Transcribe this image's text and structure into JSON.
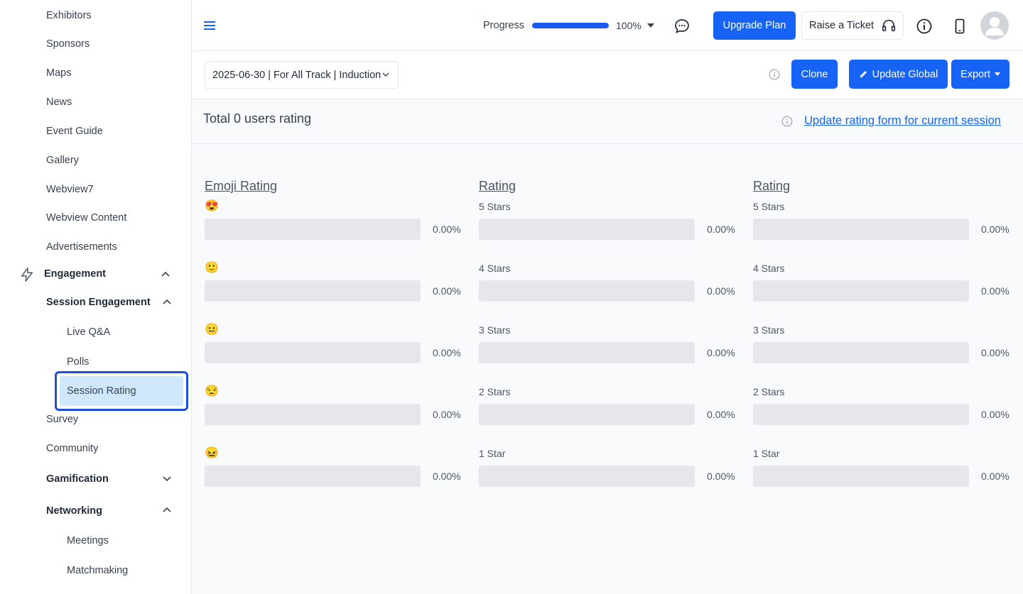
{
  "sidebar": {
    "items": {
      "exhibitors": "Exhibitors",
      "sponsors": "Sponsors",
      "maps": "Maps",
      "news": "News",
      "event_guide": "Event Guide",
      "gallery": "Gallery",
      "webview7": "Webview7",
      "webview_content": "Webview Content",
      "advertisements": "Advertisements",
      "engagement": "Engagement",
      "session_engagement": "Session Engagement",
      "live_qa": "Live Q&A",
      "polls": "Polls",
      "session_rating": "Session Rating",
      "survey": "Survey",
      "community": "Community",
      "gamification": "Gamification",
      "networking": "Networking",
      "meetings": "Meetings",
      "matchmaking": "Matchmaking"
    }
  },
  "header": {
    "progress_label": "Progress",
    "progress_value": 100,
    "progress_text": "100%",
    "upgrade_label": "Upgrade Plan",
    "ticket_label": "Raise a Ticket"
  },
  "filter": {
    "session_select": "2025-06-30 | For All Track | Induction",
    "clone_label": "Clone",
    "update_global_label": "Update Global",
    "export_label": "Export"
  },
  "summary": {
    "total_text": "Total 0 users rating",
    "update_link": "Update rating form for current session"
  },
  "colors": {
    "accent": "#1663f5",
    "active_border": "#1d4ed8",
    "active_bg": "#cfe8fb"
  },
  "rating_columns": [
    {
      "title": "Emoji Rating",
      "rows": [
        {
          "emoji": "😍",
          "label": "",
          "value": 0,
          "pct": "0.00%"
        },
        {
          "emoji": "🙂",
          "label": "",
          "value": 0,
          "pct": "0.00%"
        },
        {
          "emoji": "😐",
          "label": "",
          "value": 0,
          "pct": "0.00%"
        },
        {
          "emoji": "😒",
          "label": "",
          "value": 0,
          "pct": "0.00%"
        },
        {
          "emoji": "😖",
          "label": "",
          "value": 0,
          "pct": "0.00%"
        }
      ]
    },
    {
      "title": "Rating",
      "rows": [
        {
          "emoji": "",
          "label": "5 Stars",
          "value": 0,
          "pct": "0.00%"
        },
        {
          "emoji": "",
          "label": "4 Stars",
          "value": 0,
          "pct": "0.00%"
        },
        {
          "emoji": "",
          "label": "3 Stars",
          "value": 0,
          "pct": "0.00%"
        },
        {
          "emoji": "",
          "label": "2 Stars",
          "value": 0,
          "pct": "0.00%"
        },
        {
          "emoji": "",
          "label": "1 Star",
          "value": 0,
          "pct": "0.00%"
        }
      ]
    },
    {
      "title": "Rating",
      "rows": [
        {
          "emoji": "",
          "label": "5 Stars",
          "value": 0,
          "pct": "0.00%"
        },
        {
          "emoji": "",
          "label": "4 Stars",
          "value": 0,
          "pct": "0.00%"
        },
        {
          "emoji": "",
          "label": "3 Stars",
          "value": 0,
          "pct": "0.00%"
        },
        {
          "emoji": "",
          "label": "2 Stars",
          "value": 0,
          "pct": "0.00%"
        },
        {
          "emoji": "",
          "label": "1 Star",
          "value": 0,
          "pct": "0.00%"
        }
      ]
    }
  ]
}
